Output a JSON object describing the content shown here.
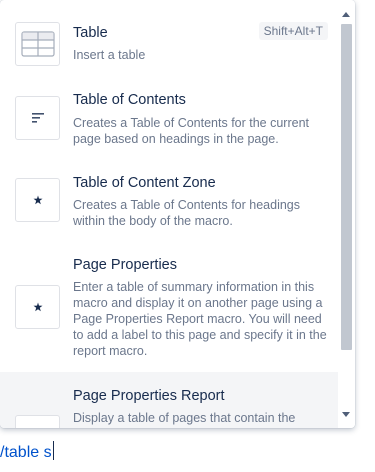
{
  "menu": {
    "items": [
      {
        "title": "Table",
        "shortcut": "Shift+Alt+T",
        "description": "Insert a table",
        "icon": "table-icon"
      },
      {
        "title": "Table of Contents",
        "description": "Creates a Table of Contents for the current page based on headings in the page.",
        "icon": "toc-lines-icon"
      },
      {
        "title": "Table of Content Zone",
        "description": "Creates a Table of Contents for headings within the body of the macro.",
        "icon": "macro-star-icon"
      },
      {
        "title": "Page Properties",
        "description": "Enter a table of summary information in this macro and display it on another page using a Page Properties Report macro. You will need to add a label to this page and specify it in the report macro.",
        "icon": "macro-star-icon"
      },
      {
        "title": "Page Properties Report",
        "description": "Display a table of pages that contain the",
        "icon": "macro-star-icon"
      }
    ]
  },
  "editor": {
    "typed_text": "/table s"
  }
}
